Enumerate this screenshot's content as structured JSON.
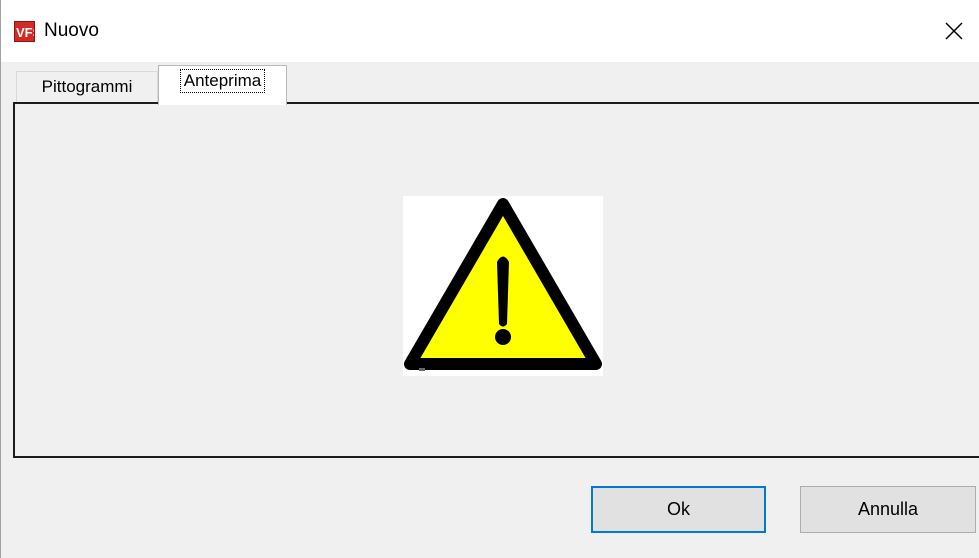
{
  "window": {
    "title": "Nuovo",
    "icon": "vfs-app-icon",
    "close_icon": "close-icon"
  },
  "tabs": [
    {
      "label": "Pittogrammi",
      "active": false
    },
    {
      "label": "Anteprima",
      "active": true
    }
  ],
  "preview": {
    "icon": "warning-triangle-icon",
    "colors": {
      "fill": "#ffff00",
      "stroke": "#000000"
    }
  },
  "buttons": {
    "ok_label": "Ok",
    "cancel_label": "Annulla"
  },
  "colors": {
    "accent": "#0078d7",
    "app_icon": "#d42a26"
  }
}
